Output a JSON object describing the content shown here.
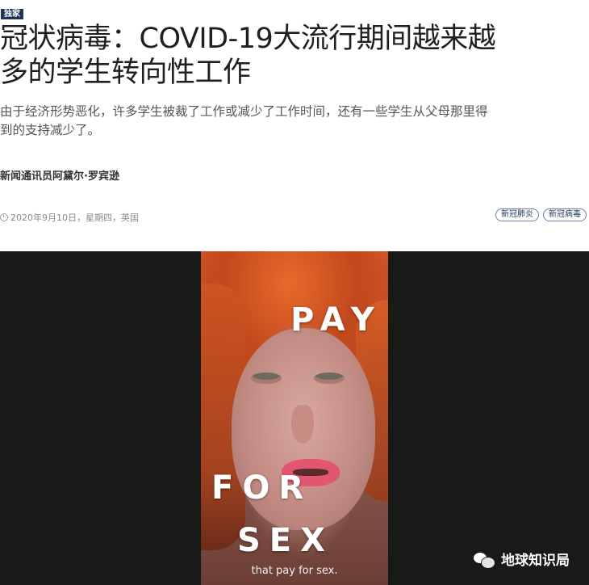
{
  "article": {
    "badge": "独家",
    "headline": "冠状病毒：COVID-19大流行期间越来越多的学生转向性工作",
    "summary": "由于经济形势恶化，许多学生被裁了工作或减少了工作时间，还有一些学生从父母那里得到的支持减少了。",
    "byline": "新闻通讯员阿黛尔·罗宾逊",
    "date": "2020年9月10日，星期四，英国",
    "tags": [
      "新冠肺炎",
      "新冠病毒"
    ]
  },
  "video": {
    "overlay_words": [
      "PAY",
      "FOR",
      "SEX"
    ],
    "subtitle": "that pay for sex."
  },
  "watermark": {
    "icon": "wechat-icon",
    "text": "地球知识局"
  },
  "colors": {
    "badge_bg": "#1d3557",
    "video_bg": "#171a17",
    "tag_border": "#6b7fa8"
  }
}
